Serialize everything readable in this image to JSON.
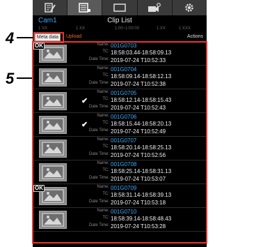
{
  "tabs": [
    {
      "icon": "clip-edit-icon"
    },
    {
      "icon": "clip-list-icon",
      "active": true
    },
    {
      "icon": "monitor-icon"
    },
    {
      "icon": "camera-settings-icon"
    },
    {
      "icon": "gear-icon"
    }
  ],
  "header": {
    "camera": "Cam1",
    "title": "Clip List"
  },
  "column_hints": [
    "1 XX",
    "1 XX",
    "1:00~1:00:00",
    "1:XX",
    "1:XXX"
  ],
  "toolbar": {
    "metadata_label": "Meta data",
    "upload_label": "Upload",
    "actions_label": "Actions"
  },
  "labels": {
    "name": "Name:",
    "tc": "TC:",
    "datetime": "Date Time:"
  },
  "clips": [
    {
      "name": "001G0703",
      "tc": "18:58:03.44-18:58:09.13",
      "datetime": "2019-07-24 T10:52:33",
      "ok": true,
      "checked": false
    },
    {
      "name": "001G0704",
      "tc": "18:58:09.14-18:58:12.13",
      "datetime": "2019-07-24 T10:52:38",
      "ok": false,
      "checked": false
    },
    {
      "name": "001G0705",
      "tc": "18:58:12.14-18:58:15.43",
      "datetime": "2019-07-24 T10:52:43",
      "ok": false,
      "checked": true
    },
    {
      "name": "001G0706",
      "tc": "18:58:15.44-18:58:20.13",
      "datetime": "2019-07-24 T10:52:49",
      "ok": false,
      "checked": true
    },
    {
      "name": "001G0707",
      "tc": "18:58:20.14-18:58:25.13",
      "datetime": "2019-07-24 T10:52:56",
      "ok": false,
      "checked": false
    },
    {
      "name": "001G0708",
      "tc": "18:58:25.14-18:58:31.13",
      "datetime": "2019-07-24 T10:53:07",
      "ok": false,
      "checked": false
    },
    {
      "name": "001G0709",
      "tc": "18:58:31.14-18:58:39.13",
      "datetime": "2019-07-24 T10:53:18",
      "ok": true,
      "checked": false
    },
    {
      "name": "001G0710",
      "tc": "18:58:39.14-18:58:48.43",
      "datetime": "2019-07-24 T10:53:28",
      "ok": false,
      "checked": false
    }
  ],
  "callouts": {
    "metadata": "4",
    "list": "5"
  },
  "colors": {
    "name_text": "#3fa9f5",
    "upload_text": "#e86a2a",
    "highlight_frame": "#e8362f"
  }
}
